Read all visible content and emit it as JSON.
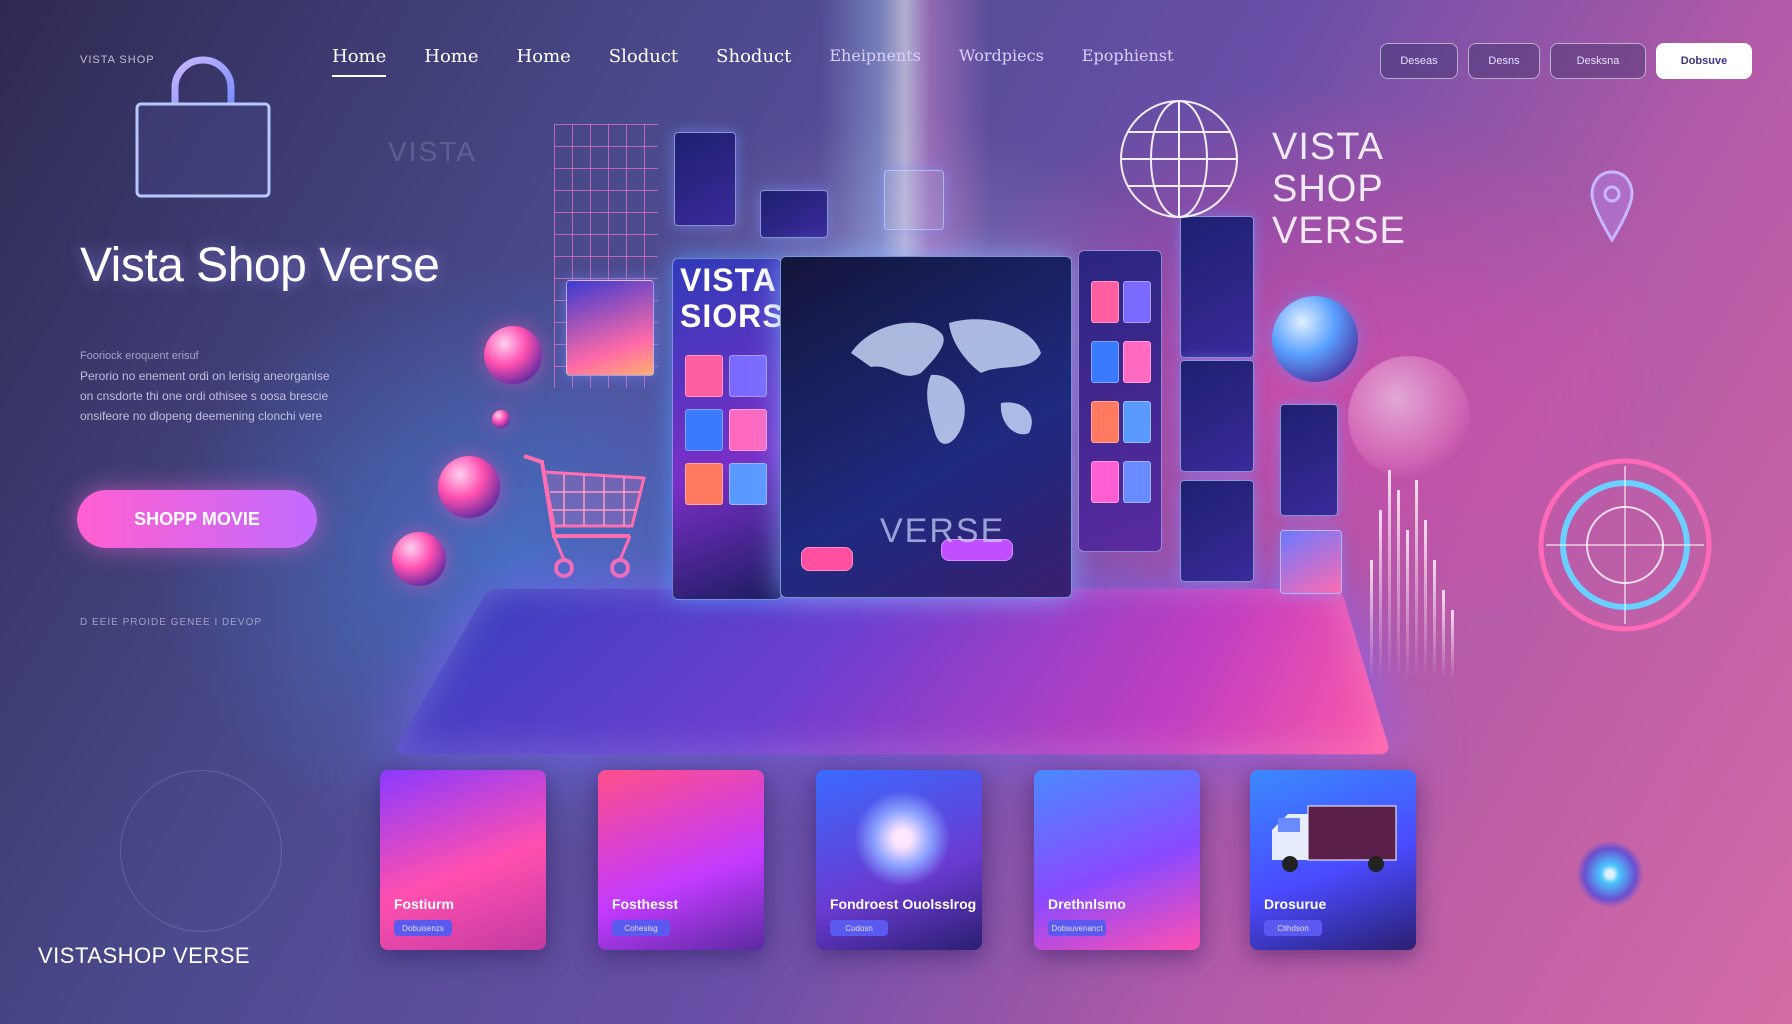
{
  "header": {
    "brand_small": "VISTA SHOP",
    "nav": [
      "Home",
      "Home",
      "Home",
      "Sloduct",
      "Shoduct",
      "Eheipnents",
      "Wordpiecs",
      "Epophienst"
    ],
    "buttons": [
      "Deseas",
      "Desns",
      "Desksna",
      "Dobsuve"
    ]
  },
  "hero": {
    "ghost_text": "VISTA",
    "title": "Vista Shop Verse",
    "description": [
      "Fooriock eroquent erisuf",
      "Perorio no enement ordi on lerisig aneorganise",
      "on cnsdorte thi one ordi othisee s oosa brescie",
      "onsifeore no dlopeng deemening clonchi vere"
    ],
    "cta": "SHOPP MOVIE",
    "meta": "D EEIE  PROIDE  GENEE  I  DEVOP"
  },
  "center": {
    "book_logo": [
      "VISTA",
      "SIORSE"
    ],
    "book_verse": "VERSE"
  },
  "right_brand": [
    "VISTA",
    "SHOP",
    "VERSE"
  ],
  "categories": [
    {
      "label": "Fostiurm",
      "chip": "Dobuisenzs"
    },
    {
      "label": "Fosthesst",
      "chip": "Cohesisg"
    },
    {
      "label": "Fondroest Ouolsslrog",
      "chip": "Cudosn"
    },
    {
      "label": "Drethnlsmo",
      "chip": "Dobsuvenanct"
    },
    {
      "label": "Drosurue",
      "chip": "Ctihdson"
    }
  ],
  "footer": {
    "brand": "VISTASHOP VERSE"
  },
  "colors": {
    "accent_pink": "#ff5fd0",
    "accent_violet": "#c26bff",
    "accent_blue": "#5a5af0"
  },
  "icons": [
    "shopping-bag-icon",
    "shopping-cart-icon",
    "globe-icon",
    "location-pin-icon",
    "target-icon",
    "delivery-truck-icon"
  ]
}
